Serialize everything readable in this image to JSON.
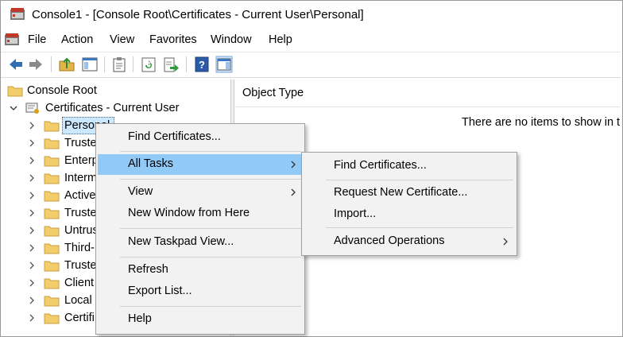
{
  "window": {
    "title": "Console1 - [Console Root\\Certificates - Current User\\Personal]"
  },
  "menu": [
    "File",
    "Action",
    "View",
    "Favorites",
    "Window",
    "Help"
  ],
  "tree": {
    "root": "Console Root",
    "certs": "Certificates - Current User",
    "children": [
      "Personal",
      "Truste",
      "Enterp",
      "Interm",
      "Active",
      "Truste",
      "Untrus",
      "Third-",
      "Truste",
      "Client",
      "Local",
      "Certifi"
    ]
  },
  "results": {
    "column": "Object Type",
    "empty": "There are no items to show in th"
  },
  "context_menu": {
    "find": "Find Certificates...",
    "all_tasks": "All Tasks",
    "view": "View",
    "new_window": "New Window from Here",
    "new_taskpad": "New Taskpad View...",
    "refresh": "Refresh",
    "export": "Export List...",
    "help": "Help"
  },
  "submenu": {
    "find": "Find Certificates...",
    "request": "Request New Certificate...",
    "import": "Import...",
    "advanced": "Advanced Operations"
  }
}
